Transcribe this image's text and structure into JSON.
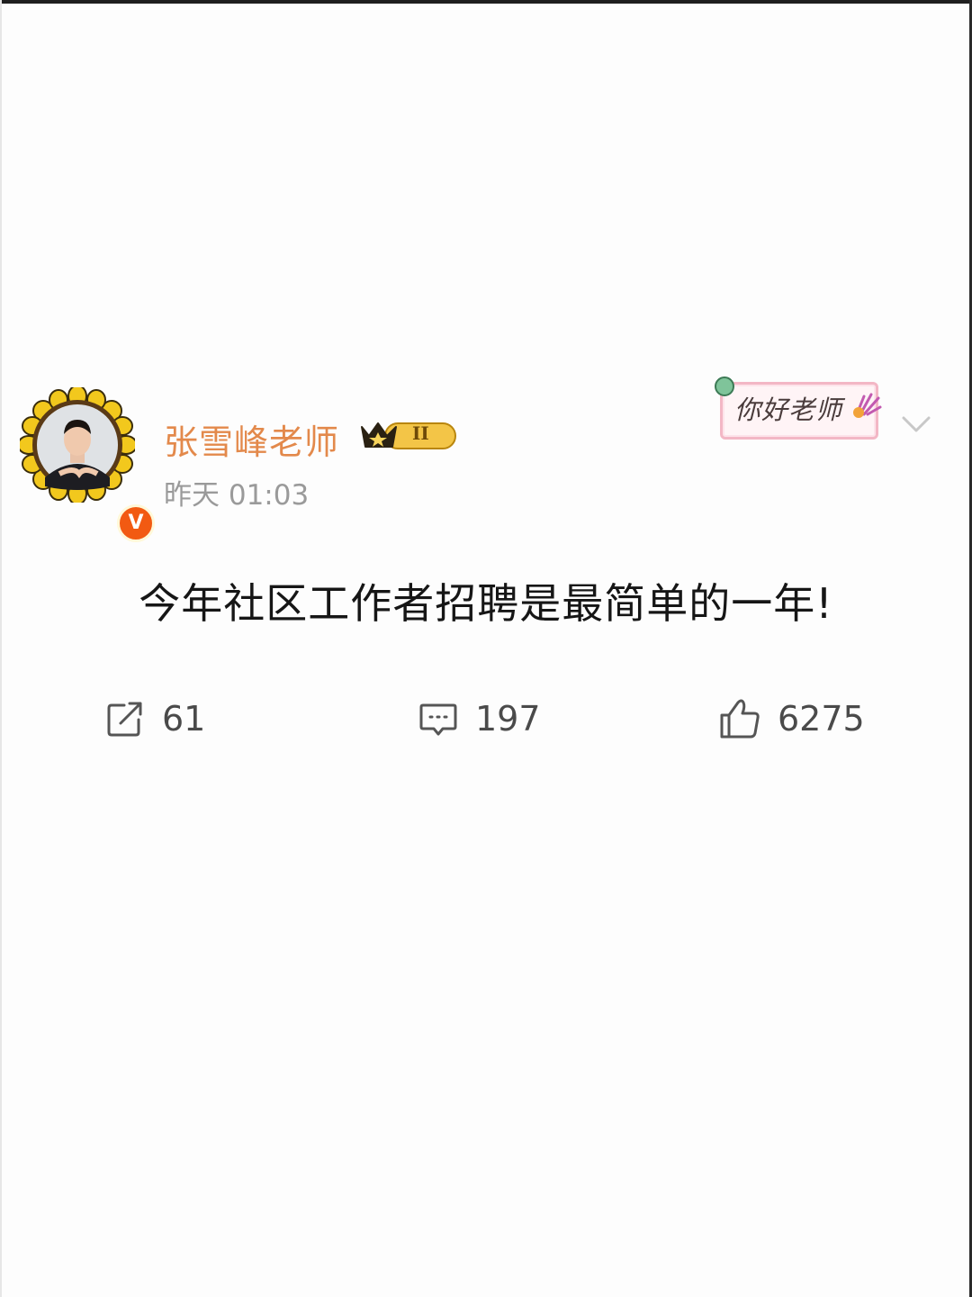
{
  "post": {
    "author": {
      "name": "张雪峰老师",
      "verified_badge": "V",
      "member_level": "II"
    },
    "timestamp": "昨天 01:03",
    "sticker_text": "你好老师",
    "content": "今年社区工作者招聘是最简单的一年!",
    "actions": {
      "repost_count": "61",
      "comment_count": "197",
      "like_count": "6275"
    }
  },
  "icons": {
    "repost": "share-arrow-icon",
    "comment": "comment-bubble-icon",
    "like": "thumbs-up-icon",
    "more": "chevron-down-icon",
    "crown": "crown-icon"
  },
  "colors": {
    "username": "#e3894b",
    "timestamp": "#9a9a9a",
    "verified": "#f25a12",
    "content_text": "#161616",
    "action_text": "#4a4a4a"
  }
}
